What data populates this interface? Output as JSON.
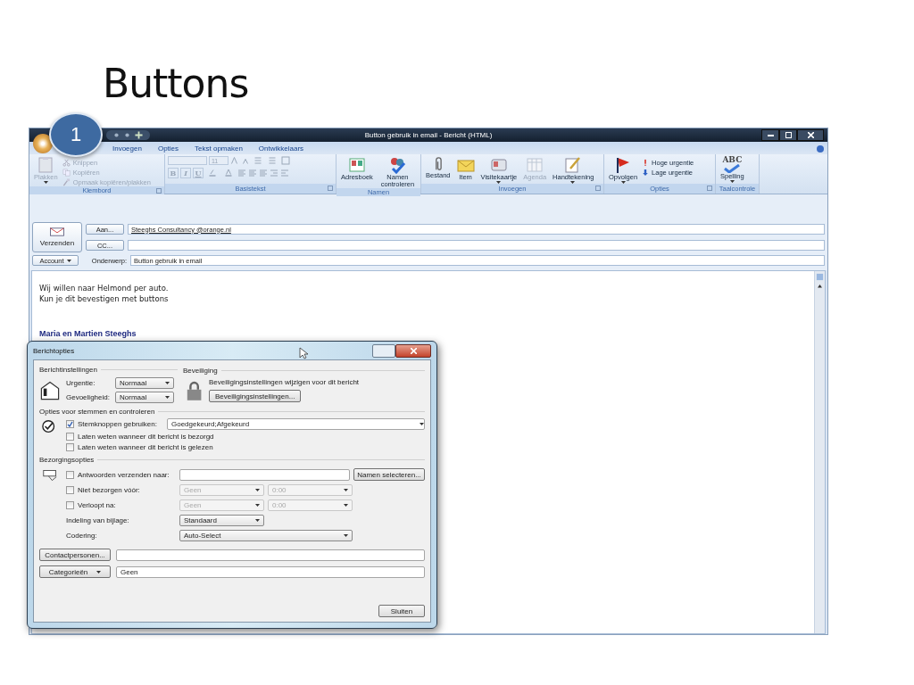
{
  "slide": {
    "title": "Buttons",
    "step_badge": "1"
  },
  "window": {
    "title": "Button gebruik in email - Bericht (HTML)"
  },
  "tabs": [
    {
      "label": "Invoegen",
      "selected": false
    },
    {
      "label": "Opties",
      "selected": false
    },
    {
      "label": "Tekst opmaken",
      "selected": false
    },
    {
      "label": "Ontwikkelaars",
      "selected": false
    }
  ],
  "ribbon": {
    "groups": [
      {
        "label": "Klembord",
        "kind": "buttons",
        "launcher": true,
        "items": [
          {
            "kind": "large",
            "label": "Plakken",
            "disabled": true,
            "menu": true
          },
          {
            "kind": "small",
            "label": "Knippen",
            "disabled": true
          },
          {
            "kind": "small",
            "label": "Kopiëren",
            "disabled": true
          },
          {
            "kind": "small",
            "label": "Opmaak kopiëren/plakken",
            "disabled": true
          }
        ]
      },
      {
        "label": "Basistekst",
        "kind": "font",
        "launcher": true,
        "font_size": "11",
        "format_buttons": [
          "B",
          "I",
          "U"
        ],
        "disabled": true
      },
      {
        "label": "Namen",
        "kind": "buttons",
        "launcher": false,
        "items": [
          {
            "kind": "large",
            "label": "Adresboek",
            "disabled": false
          },
          {
            "kind": "large",
            "label": "Namen controleren",
            "disabled": false
          }
        ]
      },
      {
        "label": "Invoegen",
        "kind": "buttons",
        "launcher": true,
        "items": [
          {
            "kind": "large",
            "label": "Bestand",
            "disabled": false
          },
          {
            "kind": "large",
            "label": "Item",
            "disabled": false
          },
          {
            "kind": "large",
            "label": "Visitekaartje",
            "disabled": false,
            "menu": true
          },
          {
            "kind": "large",
            "label": "Agenda",
            "disabled": true
          },
          {
            "kind": "large",
            "label": "Handtekening",
            "disabled": false,
            "menu": true
          }
        ]
      },
      {
        "label": "Opties",
        "kind": "buttons",
        "launcher": true,
        "items": [
          {
            "kind": "large",
            "label": "Opvolgen",
            "disabled": false,
            "menu": true
          },
          {
            "kind": "small",
            "label": "Hoge urgentie",
            "disabled": false
          },
          {
            "kind": "small",
            "label": "Lage urgentie",
            "disabled": false
          }
        ]
      },
      {
        "label": "Taalcontrole",
        "kind": "buttons",
        "launcher": false,
        "items": [
          {
            "kind": "large",
            "label": "Spelling",
            "disabled": false,
            "menu": true,
            "icon_text": "ABC"
          }
        ]
      }
    ]
  },
  "header": {
    "send_button": "Verzenden",
    "to_button": "Aan...",
    "to_value": "Steeghs Consultancy @orange.nl",
    "cc_button": "CC...",
    "account_button": "Account",
    "subject_label": "Onderwerp:",
    "subject_value": "Button gebruik in email"
  },
  "body": {
    "lines": [
      "Wij willen naar Helmond per auto.",
      "Kun je dit bevestigen met buttons"
    ],
    "signature": "Maria en Martien Steeghs"
  },
  "dialog": {
    "title": "Berichtopties",
    "settings": {
      "heading": "Berichtinstellingen",
      "fields": [
        {
          "label": "Urgentie:",
          "value": "Normaal"
        },
        {
          "label": "Gevoeligheid:",
          "value": "Normaal"
        }
      ]
    },
    "security": {
      "heading": "Beveiliging",
      "text": "Beveiligingsinstellingen wijzigen voor dit bericht",
      "button": "Beveiligingsinstellingen..."
    },
    "voting": {
      "heading": "Opties voor stemmen en controleren",
      "rows": [
        {
          "label": "Stemknoppen gebruiken:",
          "checked": true,
          "value": "Goedgekeurd;Afgekeurd"
        },
        {
          "label": "Laten weten wanneer dit bericht is bezorgd",
          "checked": false
        },
        {
          "label": "Laten weten wanneer dit bericht is gelezen",
          "checked": false
        }
      ]
    },
    "delivery": {
      "heading": "Bezorgingsopties",
      "rows": [
        {
          "kind": "reply",
          "label": "Antwoorden verzenden naar:",
          "checked": false,
          "button": "Namen selecteren..."
        },
        {
          "kind": "dates",
          "label": "Niet bezorgen vóór:",
          "checked": false,
          "date": "Geen",
          "time": "0:00"
        },
        {
          "kind": "dates",
          "label": "Verloopt na:",
          "checked": false,
          "date": "Geen",
          "time": "0:00"
        },
        {
          "kind": "select",
          "label": "Indeling van bijlage:",
          "value": "Standaard"
        },
        {
          "kind": "wide_select",
          "label": "Codering:",
          "value": "Auto-Select"
        }
      ]
    },
    "contacts_button": "Contactpersonen...",
    "categories_button": "Categorieën",
    "categories_value": "Geen",
    "close_button": "Sluiten"
  }
}
